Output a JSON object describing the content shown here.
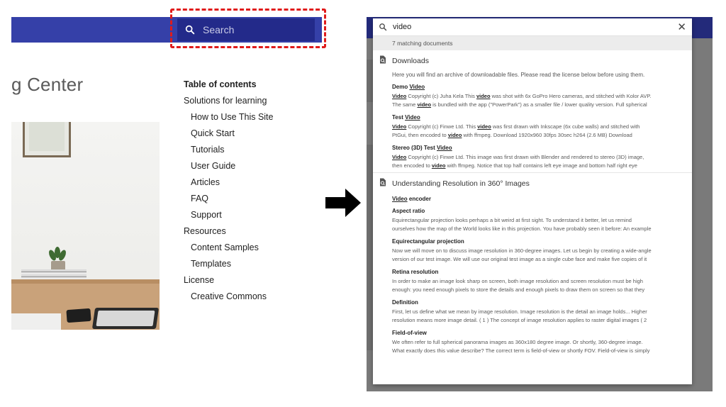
{
  "left": {
    "search": {
      "placeholder": "Search"
    },
    "page_title": "g Center",
    "toc": {
      "title": "Table of contents",
      "items": [
        {
          "label": "Solutions for learning",
          "level": 1
        },
        {
          "label": "How to Use This Site",
          "level": 2
        },
        {
          "label": "Quick Start",
          "level": 2
        },
        {
          "label": "Tutorials",
          "level": 2
        },
        {
          "label": "User Guide",
          "level": 2
        },
        {
          "label": "Articles",
          "level": 2
        },
        {
          "label": "FAQ",
          "level": 2
        },
        {
          "label": "Support",
          "level": 2
        },
        {
          "label": "Resources",
          "level": 1
        },
        {
          "label": "Content Samples",
          "level": 2
        },
        {
          "label": "Templates",
          "level": 2
        },
        {
          "label": "License",
          "level": 1
        },
        {
          "label": "Creative Commons",
          "level": 2
        }
      ]
    }
  },
  "right": {
    "query": "video",
    "close_label": "✕",
    "match_count": "7 matching documents",
    "highlight_term": "video",
    "groups": [
      {
        "title": "Downloads",
        "intro": "Here you will find an archive of downloadable files. Please read the license below before using them.",
        "items": [
          {
            "title": "Demo Video",
            "text": [
              "Video Copyright (c) Juha Kela This video was shot with 6x GoPro Hero cameras, and stitched with Kolor AVP.",
              "The same video is bundled with the app (\"PowerPark\") as a smaller file / lower quality version. Full spherical"
            ]
          },
          {
            "title": "Test Video",
            "text": [
              "Video Copyright (c) Finwe Ltd. This video was first drawn with Inkscape (6x cube walls) and stitched with",
              "PtGui, then encoded to video with ffmpeg. Download 1920x960 30fps 30sec h264 (2.6 MB) Download"
            ]
          },
          {
            "title": "Stereo (3D) Test Video",
            "text": [
              "Video Copyright (c) Finwe Ltd. This image was first drawn with Blender and rendered to stereo (3D) image,",
              "then encoded to video with ffmpeg. Notice that top half contains left eye image and bottom half right eye"
            ]
          }
        ]
      },
      {
        "title": "Understanding Resolution in 360° Images",
        "intro": "",
        "items": [
          {
            "title": "Video encoder",
            "text": []
          },
          {
            "title": "Aspect ratio",
            "text": [
              "Equirectangular projection looks perhaps a bit weird at first sight. To understand it better, let us remind",
              "ourselves how the map of the World looks like in this projection. You have probably seen it before: An example"
            ]
          },
          {
            "title": "Equirectangular projection",
            "text": [
              "Now we will move on to discuss image resolution in 360-degree images. Let us begin by creating a wide-angle",
              "version of our test image. We will use our original test image as a single cube face and make five copies of it"
            ]
          },
          {
            "title": "Retina resolution",
            "text": [
              "In order to make an image look sharp on screen, both image resolution and screen resolution must be high",
              "enough: you need enough pixels to store the details and enough pixels to draw them on screen so that they"
            ]
          },
          {
            "title": "Definition",
            "text": [
              "First, let us define what we mean by image resolution. Image resolution is the detail an image holds... Higher",
              "resolution means more image detail. ( 1 ) The concept of image resolution applies to raster digital images ( 2"
            ]
          },
          {
            "title": "Field-of-view",
            "text": [
              "We often refer to full spherical panorama images as 360x180 degree image. Or shortly, 360-degree image.",
              "What exactly does this value describe? The correct term is field-of-view or shortly FOV. Field-of-view is simply"
            ]
          }
        ]
      }
    ]
  },
  "colors": {
    "header_blue": "#3540a8",
    "search_bg": "#232a8a",
    "highlight_red": "#e01b1b"
  },
  "icons": [
    "search-icon",
    "close-icon",
    "document-icon",
    "arrow-right-icon"
  ]
}
